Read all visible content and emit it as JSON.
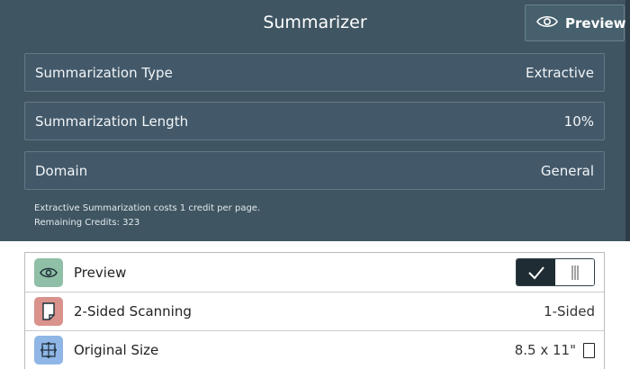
{
  "header": {
    "title": "Summarizer",
    "preview_button_label": "Preview"
  },
  "settings": [
    {
      "label": "Summarization Type",
      "value": "Extractive"
    },
    {
      "label": "Summarization Length",
      "value": "10%"
    },
    {
      "label": "Domain",
      "value": "General"
    }
  ],
  "info": {
    "cost_text": "Extractive Summarization costs 1 credit per page.",
    "credits_text": "Remaining Credits: 323"
  },
  "options": [
    {
      "label": "Preview",
      "icon": "eye-icon",
      "icon_bg": "#8fbfa6",
      "state": "on"
    },
    {
      "label": "2-Sided Scanning",
      "icon": "page-icon",
      "icon_bg": "#d9928c",
      "value": "1-Sided"
    },
    {
      "label": "Original Size",
      "icon": "resize-icon",
      "icon_bg": "#8fb6e6",
      "value": "8.5 x 11\""
    }
  ],
  "colors": {
    "panel_bg": "#3f5562",
    "toggle_on": "#1f2c34"
  }
}
